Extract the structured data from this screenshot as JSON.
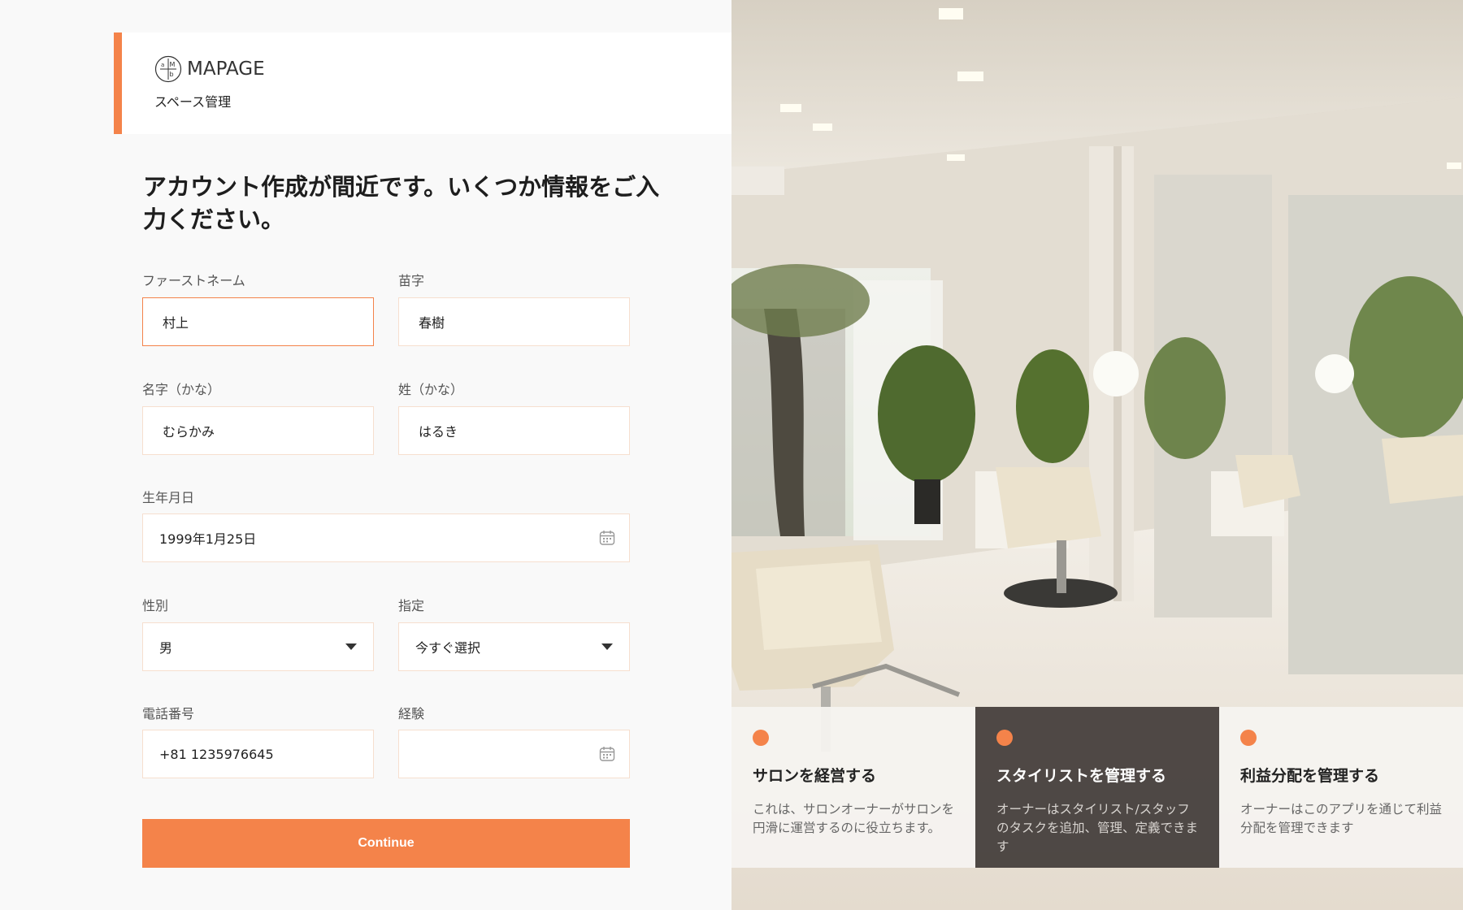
{
  "brand": {
    "name": "MAPAGE",
    "subtitle": "スペース管理",
    "accent_color": "#f4834a"
  },
  "headline": "アカウント作成が間近です。いくつか情報をご入力ください。",
  "form": {
    "first_name": {
      "label": "ファーストネーム",
      "value": "村上"
    },
    "last_name": {
      "label": "苗字",
      "value": "春樹"
    },
    "first_name_kana": {
      "label": "名字（かな）",
      "value": "むらかみ"
    },
    "last_name_kana": {
      "label": "姓（かな）",
      "value": "はるき"
    },
    "birthdate": {
      "label": "生年月日",
      "value": "1999年1月25日",
      "icon": "calendar-icon"
    },
    "gender": {
      "label": "性別",
      "value": "男",
      "icon": "caret-down-icon"
    },
    "designation": {
      "label": "指定",
      "value": "今すぐ選択",
      "icon": "caret-down-icon"
    },
    "phone": {
      "label": "電話番号",
      "value": "+81 1235976645"
    },
    "experience": {
      "label": "経験",
      "value": "",
      "icon": "calendar-icon"
    },
    "continue_label": "Continue"
  },
  "feature_cards": [
    {
      "title": "サロンを経営する",
      "text": "これは、サロンオーナーがサロンを円滑に運営するのに役立ちます。",
      "theme": "light"
    },
    {
      "title": "スタイリストを管理する",
      "text": "オーナーはスタイリスト/スタッフのタスクを追加、管理、定義できます",
      "theme": "dark"
    },
    {
      "title": "利益分配を管理する",
      "text": "オーナーはこのアプリを通じて利益分配を管理できます",
      "theme": "light"
    }
  ]
}
